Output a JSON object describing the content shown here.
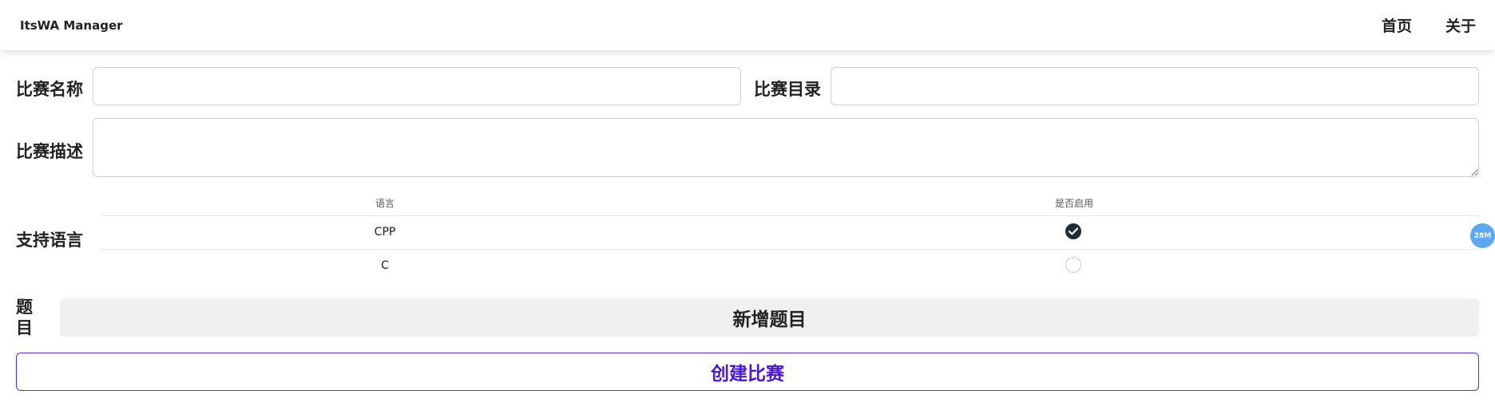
{
  "navbar": {
    "brand": "ItsWA Manager",
    "links": [
      {
        "label": "首页"
      },
      {
        "label": "关于"
      }
    ]
  },
  "form": {
    "name_label": "比赛名称",
    "name_value": "",
    "directory_label": "比赛目录",
    "directory_value": "",
    "description_label": "比赛描述",
    "description_value": "",
    "languages_label": "支持语言",
    "languages_table": {
      "headers": [
        "语言",
        "是否启用"
      ],
      "rows": [
        {
          "language": "CPP",
          "enabled": true
        },
        {
          "language": "C",
          "enabled": false
        }
      ]
    },
    "problems_label_line1": "题",
    "problems_label_line2": "目",
    "add_problem_button": "新增题目",
    "create_button": "创建比赛"
  },
  "floating_badge": "28M",
  "colors": {
    "accent": "#4a17d6",
    "checked": "#212a37",
    "add_button_bg": "#f0f0f0",
    "badge": "#5ea8f2"
  }
}
